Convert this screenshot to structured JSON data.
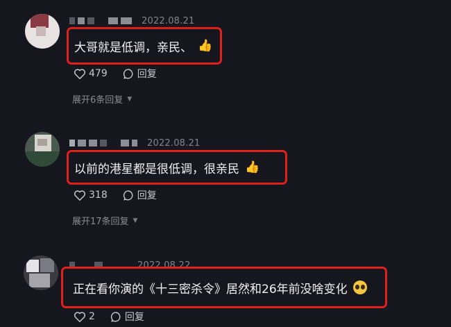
{
  "comments": [
    {
      "date": "2022.08.21",
      "text": "大哥就是低调，亲民、",
      "emoji": "thumbs-up",
      "likes": "479",
      "reply_label": "回复",
      "expand_label": "展开6条回复"
    },
    {
      "date": "2022.08.21",
      "text": "以前的港星都是很低调，很亲民",
      "emoji": "thumbs-up",
      "likes": "318",
      "reply_label": "回复",
      "expand_label": "展开17条回复"
    },
    {
      "date": "2022.08.22",
      "text": "正在看你演的《十三密杀令》居然和26年前没啥变化",
      "emoji": "pleading-face",
      "likes": "2",
      "reply_label": "回复"
    }
  ],
  "colors": {
    "background": "#16161e",
    "highlight_border": "#e0201a",
    "muted_text": "#83838c"
  }
}
